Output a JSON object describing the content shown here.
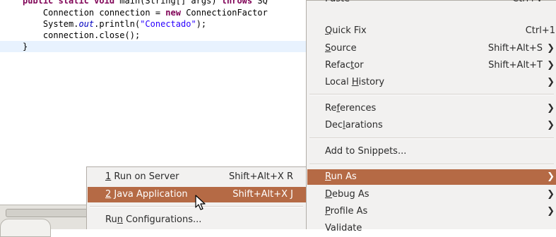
{
  "editor": {
    "line0": {
      "kw1": "public static void",
      "mid": " main(String[] args) ",
      "kw2": "throws",
      "tail": " SQ"
    },
    "line1": {
      "pre": "    Connection connection = ",
      "kw": "new",
      "post": " ConnectionFactor"
    },
    "line2": {
      "pre": "    System.",
      "fld": "out",
      "mid": ".println(",
      "str": "\"Conectado\"",
      "post": ");"
    },
    "line3": {
      "text": "    connection.close();"
    },
    "line4": {
      "text": "}"
    }
  },
  "context_menu": {
    "top_partial": {
      "label": "Paste",
      "accel": "Ctrl+V"
    },
    "items": [
      {
        "label": "Quick Fix",
        "accel": "Ctrl+1",
        "submenu": false
      },
      {
        "label": "Source",
        "accel": "Shift+Alt+S",
        "submenu": true
      },
      {
        "label": "Refactor",
        "accel": "Shift+Alt+T",
        "submenu": true
      },
      {
        "label": "Local History",
        "accel": "",
        "submenu": true
      },
      {
        "label": "References",
        "accel": "",
        "submenu": true
      },
      {
        "label": "Declarations",
        "accel": "",
        "submenu": true
      },
      {
        "label": "Add to Snippets...",
        "accel": "",
        "submenu": false
      },
      {
        "label": "Run As",
        "accel": "",
        "submenu": true
      },
      {
        "label": "Debug As",
        "accel": "",
        "submenu": true
      },
      {
        "label": "Profile As",
        "accel": "",
        "submenu": true
      },
      {
        "label": "Validate",
        "accel": "",
        "submenu": false
      }
    ],
    "submenu_arrow": "❯"
  },
  "run_submenu": {
    "items": [
      {
        "label": "1 Run on Server",
        "accel": "Shift+Alt+X R"
      },
      {
        "label": "2 Java Application",
        "accel": "Shift+Alt+X J"
      },
      {
        "label": "Run Configurations...",
        "accel": ""
      }
    ]
  },
  "colors": {
    "highlight": "#b56a45",
    "menu_bg": "#f2f1f0",
    "keyword": "#7f0055",
    "string": "#2a00ff"
  },
  "icons": {
    "pointer": "mouse-pointer-icon"
  }
}
